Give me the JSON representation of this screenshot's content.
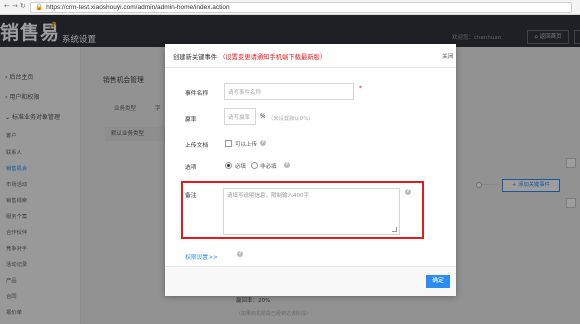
{
  "browser": {
    "url": "https://crm-test.xiaoshouyi.com/admin/admin-home/index.action",
    "back_icon": "arrow-left-icon",
    "forward_icon": "arrow-right-icon",
    "reload_icon": "reload-icon"
  },
  "header": {
    "logo": "销售易",
    "title": "系统设置",
    "welcome": "欢迎您：chenhuan",
    "back_button": "返回首页"
  },
  "sidebar": {
    "items": [
      {
        "label": "后台主页",
        "arrow": "›"
      },
      {
        "label": "用户和权限",
        "arrow": "›"
      },
      {
        "label": "标准业务对象管理",
        "arrow": "⌄"
      }
    ],
    "sub_items": [
      {
        "label": "客户",
        "active": false
      },
      {
        "label": "联系人",
        "active": false
      },
      {
        "label": "销售机会",
        "active": true
      },
      {
        "label": "市场活动",
        "active": false
      },
      {
        "label": "销售线索",
        "active": false
      },
      {
        "label": "服务个案",
        "active": false
      },
      {
        "label": "合作伙伴",
        "active": false
      },
      {
        "label": "竞争对手",
        "active": false
      },
      {
        "label": "活动记录",
        "active": false
      },
      {
        "label": "产品",
        "active": false
      },
      {
        "label": "合同",
        "active": false
      },
      {
        "label": "报价单",
        "active": false
      }
    ]
  },
  "main": {
    "title": "销售机会管理",
    "tab_1": "业务类型",
    "tab_2": "字",
    "category_row": "默认业务类型",
    "add_event_button": "+ 添加关键事件",
    "win_rate": "赢回率：20%",
    "win_note": "（如果商机阶段已经到达该阶段）"
  },
  "modal": {
    "title": "创建新关键事件",
    "warning": "（设置变更请通知手机端下载最新版）",
    "close": "关闭",
    "name_label": "事件名称",
    "name_placeholder": "请写事件名称",
    "required_mark": "*",
    "win_label": "赢率",
    "win_placeholder": "请写赢率",
    "win_unit": "%",
    "win_hint": "（未设置默认0%）",
    "upload_label": "上传文档",
    "upload_option": "可以上传",
    "options_label": "选项",
    "option_required": "必填",
    "option_optional": "非必填",
    "note_label": "备注",
    "note_placeholder": "请填写说明信息，限制输入400字",
    "perm_link": "权限设置>>",
    "confirm_button": "确定"
  },
  "colors": {
    "header_bg": "#30343d",
    "accent": "#2d8cf0",
    "highlight": "#e01c1c",
    "logo_mark": "#f39c12"
  }
}
